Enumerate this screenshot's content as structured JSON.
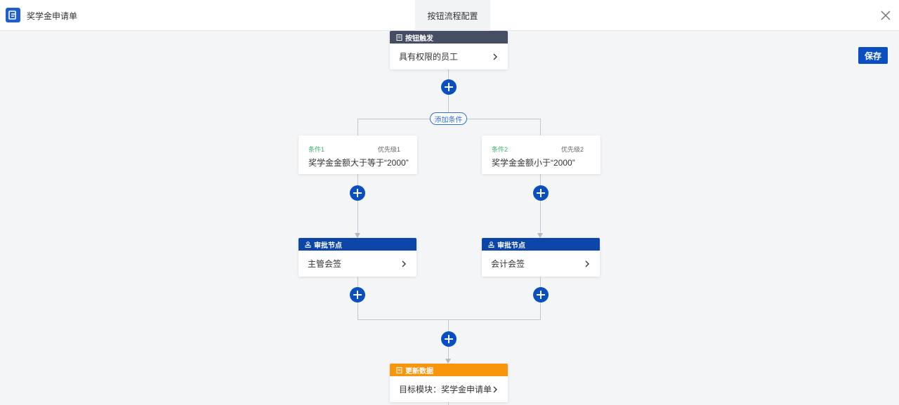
{
  "header": {
    "app_title": "奖学金申请单",
    "center_tab": "按钮流程配置",
    "close_icon": "close-icon",
    "app_icon": "app-logo-icon"
  },
  "toolbar": {
    "save_label": "保存",
    "accent": "#0a4fc2"
  },
  "flow": {
    "trigger": {
      "header": "按钮触发",
      "body": "具有权限的员工",
      "color": "#454e62"
    },
    "add_condition_label": "添加条件",
    "conditions": [
      {
        "name": "条件1",
        "priority": "优先级1",
        "text": "奖学金金额大于等于“2000”"
      },
      {
        "name": "条件2",
        "priority": "优先级2",
        "text": "奖学金金额小于“2000”"
      }
    ],
    "approvals": [
      {
        "header": "审批节点",
        "body": "主管会签",
        "color": "#0b46a8"
      },
      {
        "header": "审批节点",
        "body": "会计会签",
        "color": "#0b46a8"
      }
    ],
    "update": {
      "header": "更新数据",
      "body": "目标模块：奖学金申请单",
      "color": "#f7950c"
    }
  }
}
